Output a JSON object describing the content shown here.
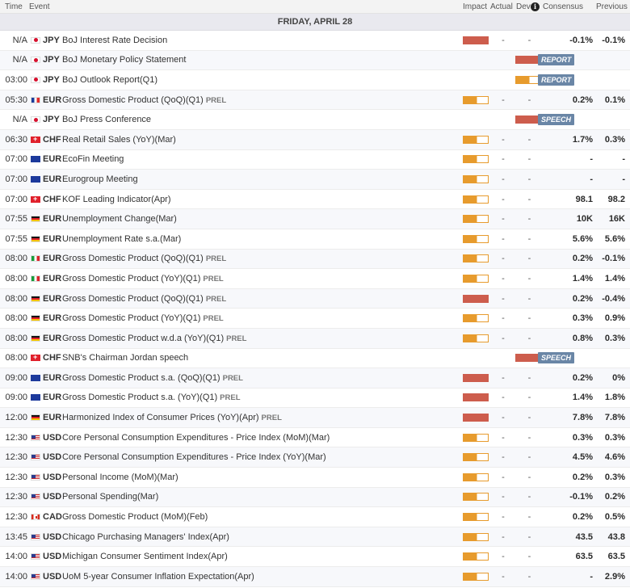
{
  "header": {
    "time": "Time",
    "event": "Event",
    "impact": "Impact",
    "actual": "Actual",
    "dev": "Dev",
    "info": "i",
    "consensus": "Consensus",
    "previous": "Previous"
  },
  "date_label": "FRIDAY, APRIL 28",
  "colors": {
    "high_impact": "#cd5d4d",
    "medium_impact": "#e79b2d",
    "badge": "#6a86a6"
  },
  "rows": [
    {
      "time": "N/A",
      "flag": "jpy",
      "cur": "JPY",
      "event": "BoJ Interest Rate Decision",
      "prel": "",
      "impact": "high",
      "actual": "-",
      "dev": "-",
      "cons": "-0.1%",
      "prev": "-0.1%",
      "badge": ""
    },
    {
      "time": "N/A",
      "flag": "jpy",
      "cur": "JPY",
      "event": "BoJ Monetary Policy Statement",
      "prel": "",
      "impact": "high",
      "actual": "",
      "dev": "",
      "cons": "",
      "prev": "",
      "badge": "REPORT"
    },
    {
      "time": "03:00",
      "flag": "jpy",
      "cur": "JPY",
      "event": "BoJ Outlook Report(Q1)",
      "prel": "",
      "impact": "med",
      "actual": "",
      "dev": "",
      "cons": "",
      "prev": "",
      "badge": "REPORT"
    },
    {
      "time": "05:30",
      "flag": "fr",
      "cur": "EUR",
      "event": "Gross Domestic Product (QoQ)(Q1)",
      "prel": "PREL",
      "impact": "med",
      "actual": "-",
      "dev": "-",
      "cons": "0.2%",
      "prev": "0.1%",
      "badge": ""
    },
    {
      "time": "N/A",
      "flag": "jpy",
      "cur": "JPY",
      "event": "BoJ Press Conference",
      "prel": "",
      "impact": "high",
      "actual": "",
      "dev": "",
      "cons": "",
      "prev": "",
      "badge": "SPEECH"
    },
    {
      "time": "06:30",
      "flag": "chf",
      "cur": "CHF",
      "event": "Real Retail Sales (YoY)(Mar)",
      "prel": "",
      "impact": "med",
      "actual": "-",
      "dev": "-",
      "cons": "1.7%",
      "prev": "0.3%",
      "badge": ""
    },
    {
      "time": "07:00",
      "flag": "eur",
      "cur": "EUR",
      "event": "EcoFin Meeting",
      "prel": "",
      "impact": "med",
      "actual": "-",
      "dev": "-",
      "cons": "-",
      "prev": "-",
      "badge": ""
    },
    {
      "time": "07:00",
      "flag": "eur",
      "cur": "EUR",
      "event": "Eurogroup Meeting",
      "prel": "",
      "impact": "med",
      "actual": "-",
      "dev": "-",
      "cons": "-",
      "prev": "-",
      "badge": ""
    },
    {
      "time": "07:00",
      "flag": "chf",
      "cur": "CHF",
      "event": "KOF Leading Indicator(Apr)",
      "prel": "",
      "impact": "med",
      "actual": "-",
      "dev": "-",
      "cons": "98.1",
      "prev": "98.2",
      "badge": ""
    },
    {
      "time": "07:55",
      "flag": "de",
      "cur": "EUR",
      "event": "Unemployment Change(Mar)",
      "prel": "",
      "impact": "med",
      "actual": "-",
      "dev": "-",
      "cons": "10K",
      "prev": "16K",
      "badge": ""
    },
    {
      "time": "07:55",
      "flag": "de",
      "cur": "EUR",
      "event": "Unemployment Rate s.a.(Mar)",
      "prel": "",
      "impact": "med",
      "actual": "-",
      "dev": "-",
      "cons": "5.6%",
      "prev": "5.6%",
      "badge": ""
    },
    {
      "time": "08:00",
      "flag": "it",
      "cur": "EUR",
      "event": "Gross Domestic Product (QoQ)(Q1)",
      "prel": "PREL",
      "impact": "med",
      "actual": "-",
      "dev": "-",
      "cons": "0.2%",
      "prev": "-0.1%",
      "badge": ""
    },
    {
      "time": "08:00",
      "flag": "it",
      "cur": "EUR",
      "event": "Gross Domestic Product (YoY)(Q1)",
      "prel": "PREL",
      "impact": "med",
      "actual": "-",
      "dev": "-",
      "cons": "1.4%",
      "prev": "1.4%",
      "badge": ""
    },
    {
      "time": "08:00",
      "flag": "de",
      "cur": "EUR",
      "event": "Gross Domestic Product (QoQ)(Q1)",
      "prel": "PREL",
      "impact": "high",
      "actual": "-",
      "dev": "-",
      "cons": "0.2%",
      "prev": "-0.4%",
      "badge": ""
    },
    {
      "time": "08:00",
      "flag": "de",
      "cur": "EUR",
      "event": "Gross Domestic Product (YoY)(Q1)",
      "prel": "PREL",
      "impact": "med",
      "actual": "-",
      "dev": "-",
      "cons": "0.3%",
      "prev": "0.9%",
      "badge": ""
    },
    {
      "time": "08:00",
      "flag": "de",
      "cur": "EUR",
      "event": "Gross Domestic Product w.d.a (YoY)(Q1)",
      "prel": "PREL",
      "impact": "med",
      "actual": "-",
      "dev": "-",
      "cons": "0.8%",
      "prev": "0.3%",
      "badge": ""
    },
    {
      "time": "08:00",
      "flag": "chf",
      "cur": "CHF",
      "event": "SNB's Chairman Jordan speech",
      "prel": "",
      "impact": "high",
      "actual": "",
      "dev": "",
      "cons": "",
      "prev": "",
      "badge": "SPEECH"
    },
    {
      "time": "09:00",
      "flag": "eur",
      "cur": "EUR",
      "event": "Gross Domestic Product s.a. (QoQ)(Q1)",
      "prel": "PREL",
      "impact": "high",
      "actual": "-",
      "dev": "-",
      "cons": "0.2%",
      "prev": "0%",
      "badge": ""
    },
    {
      "time": "09:00",
      "flag": "eur",
      "cur": "EUR",
      "event": "Gross Domestic Product s.a. (YoY)(Q1)",
      "prel": "PREL",
      "impact": "high",
      "actual": "-",
      "dev": "-",
      "cons": "1.4%",
      "prev": "1.8%",
      "badge": ""
    },
    {
      "time": "12:00",
      "flag": "de",
      "cur": "EUR",
      "event": "Harmonized Index of Consumer Prices (YoY)(Apr)",
      "prel": "PREL",
      "impact": "high",
      "actual": "-",
      "dev": "-",
      "cons": "7.8%",
      "prev": "7.8%",
      "badge": ""
    },
    {
      "time": "12:30",
      "flag": "us",
      "cur": "USD",
      "event": "Core Personal Consumption Expenditures - Price Index (MoM)(Mar)",
      "prel": "",
      "impact": "med",
      "actual": "-",
      "dev": "-",
      "cons": "0.3%",
      "prev": "0.3%",
      "badge": ""
    },
    {
      "time": "12:30",
      "flag": "us",
      "cur": "USD",
      "event": "Core Personal Consumption Expenditures - Price Index (YoY)(Mar)",
      "prel": "",
      "impact": "med",
      "actual": "-",
      "dev": "-",
      "cons": "4.5%",
      "prev": "4.6%",
      "badge": ""
    },
    {
      "time": "12:30",
      "flag": "us",
      "cur": "USD",
      "event": "Personal Income (MoM)(Mar)",
      "prel": "",
      "impact": "med",
      "actual": "-",
      "dev": "-",
      "cons": "0.2%",
      "prev": "0.3%",
      "badge": ""
    },
    {
      "time": "12:30",
      "flag": "us",
      "cur": "USD",
      "event": "Personal Spending(Mar)",
      "prel": "",
      "impact": "med",
      "actual": "-",
      "dev": "-",
      "cons": "-0.1%",
      "prev": "0.2%",
      "badge": ""
    },
    {
      "time": "12:30",
      "flag": "ca",
      "cur": "CAD",
      "event": "Gross Domestic Product (MoM)(Feb)",
      "prel": "",
      "impact": "med",
      "actual": "-",
      "dev": "-",
      "cons": "0.2%",
      "prev": "0.5%",
      "badge": ""
    },
    {
      "time": "13:45",
      "flag": "us",
      "cur": "USD",
      "event": "Chicago Purchasing Managers' Index(Apr)",
      "prel": "",
      "impact": "med",
      "actual": "-",
      "dev": "-",
      "cons": "43.5",
      "prev": "43.8",
      "badge": ""
    },
    {
      "time": "14:00",
      "flag": "us",
      "cur": "USD",
      "event": "Michigan Consumer Sentiment Index(Apr)",
      "prel": "",
      "impact": "med",
      "actual": "-",
      "dev": "-",
      "cons": "63.5",
      "prev": "63.5",
      "badge": ""
    },
    {
      "time": "14:00",
      "flag": "us",
      "cur": "USD",
      "event": "UoM 5-year Consumer Inflation Expectation(Apr)",
      "prel": "",
      "impact": "med",
      "actual": "-",
      "dev": "-",
      "cons": "-",
      "prev": "2.9%",
      "badge": ""
    }
  ]
}
